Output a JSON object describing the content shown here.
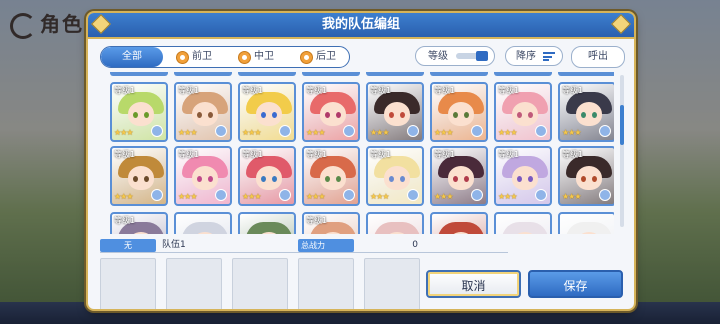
{
  "background": {
    "title": "角色一览"
  },
  "dialog": {
    "title": "我的队伍编组"
  },
  "filters": {
    "tabs": [
      {
        "label": "全部",
        "active": true
      },
      {
        "label": "前卫",
        "active": false
      },
      {
        "label": "中卫",
        "active": false
      },
      {
        "label": "后卫",
        "active": false
      }
    ],
    "level_label": "等级",
    "sort_label": "降序",
    "call_label": "呼出"
  },
  "characters": [
    {
      "level": "等级1",
      "stars": "★★★",
      "hair": "#b8d96a",
      "eye": "#6a9a2a"
    },
    {
      "level": "等级1",
      "stars": "★★★",
      "hair": "#d7a37a",
      "eye": "#8a5a3a"
    },
    {
      "level": "等级1",
      "stars": "★★★",
      "hair": "#f2cc4a",
      "eye": "#3a6ad0"
    },
    {
      "level": "等级1",
      "stars": "★★★",
      "hair": "#e86a6a",
      "eye": "#b03a6a"
    },
    {
      "level": "等级1",
      "stars": "★★★",
      "hair": "#3a2a2a",
      "eye": "#c04a3a"
    },
    {
      "level": "等级1",
      "stars": "★★★",
      "hair": "#e88a4a",
      "eye": "#5a7a3a"
    },
    {
      "level": "等级1",
      "stars": "★★★",
      "hair": "#f0a0b0",
      "eye": "#c05a7a"
    },
    {
      "level": "等级1",
      "stars": "★★★",
      "hair": "#3a3a4a",
      "eye": "#3a8a6a"
    },
    {
      "level": "等级1",
      "stars": "★★★",
      "hair": "#c08a3a",
      "eye": "#6a4a2a"
    },
    {
      "level": "等级1",
      "stars": "★★★",
      "hair": "#f08ab0",
      "eye": "#c04a8a"
    },
    {
      "level": "等级1",
      "stars": "★★★",
      "hair": "#e05a6a",
      "eye": "#3a7ac0"
    },
    {
      "level": "等级1",
      "stars": "★★★",
      "hair": "#d86a4a",
      "eye": "#5a8a4a"
    },
    {
      "level": "等级1",
      "stars": "★★★",
      "hair": "#f2e0a0",
      "eye": "#6a8ad0"
    },
    {
      "level": "等级1",
      "stars": "★★★",
      "hair": "#4a2a3a",
      "eye": "#b03a4a"
    },
    {
      "level": "等级1",
      "stars": "★★★",
      "hair": "#c0a8e0",
      "eye": "#7a5ac0"
    },
    {
      "level": "等级1",
      "stars": "★★★",
      "hair": "#3a2a2a",
      "eye": "#b04a2a"
    },
    {
      "level": "等级1",
      "stars": "",
      "hair": "#8a7a9a",
      "eye": "#3a3a5a"
    },
    {
      "level": "",
      "stars": "",
      "hair": "#d0d4e0",
      "eye": "#6a6a8a"
    },
    {
      "level": "",
      "stars": "",
      "hair": "#6a8a5a",
      "eye": "#3a5a3a"
    },
    {
      "level": "等级1",
      "stars": "",
      "hair": "#e0a080",
      "eye": "#8a4a3a"
    },
    {
      "level": "",
      "stars": "",
      "hair": "#e8c0c0",
      "eye": "#a05a6a"
    },
    {
      "level": "",
      "stars": "",
      "hair": "#c04a3a",
      "eye": "#6a2a2a"
    },
    {
      "level": "",
      "stars": "",
      "hair": "#e8e0e8",
      "eye": "#8a8aa0"
    },
    {
      "level": "",
      "stars": "",
      "hair": "#f0f0f0",
      "eye": "#a0a0a0"
    }
  ],
  "team": {
    "label": "无",
    "name": "队伍1",
    "power_label": "总战力",
    "power_value": "0"
  },
  "buttons": {
    "cancel": "取消",
    "save": "保存"
  }
}
